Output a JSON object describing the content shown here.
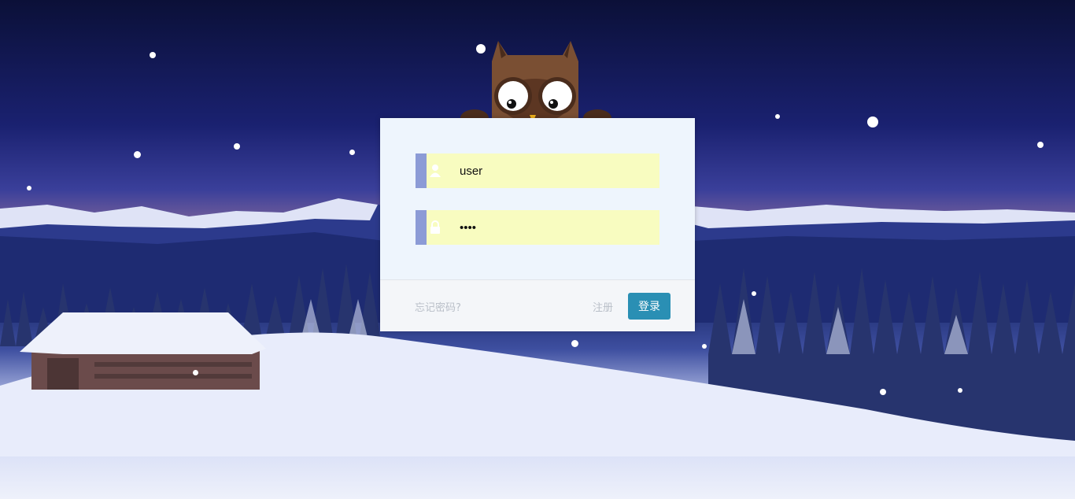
{
  "login_form": {
    "username_value": "user",
    "password_value": "1234",
    "forgot_label": "忘记密码?",
    "register_label": "注册",
    "login_label": "登录"
  },
  "colors": {
    "accent": "#2a8fb4",
    "input_bg": "#f8fcc0",
    "input_bar": "#8c9bd6",
    "panel_bg": "#eef5fd"
  },
  "icons": {
    "username": "user-icon",
    "password": "lock-icon",
    "mascot": "owl-mascot"
  }
}
